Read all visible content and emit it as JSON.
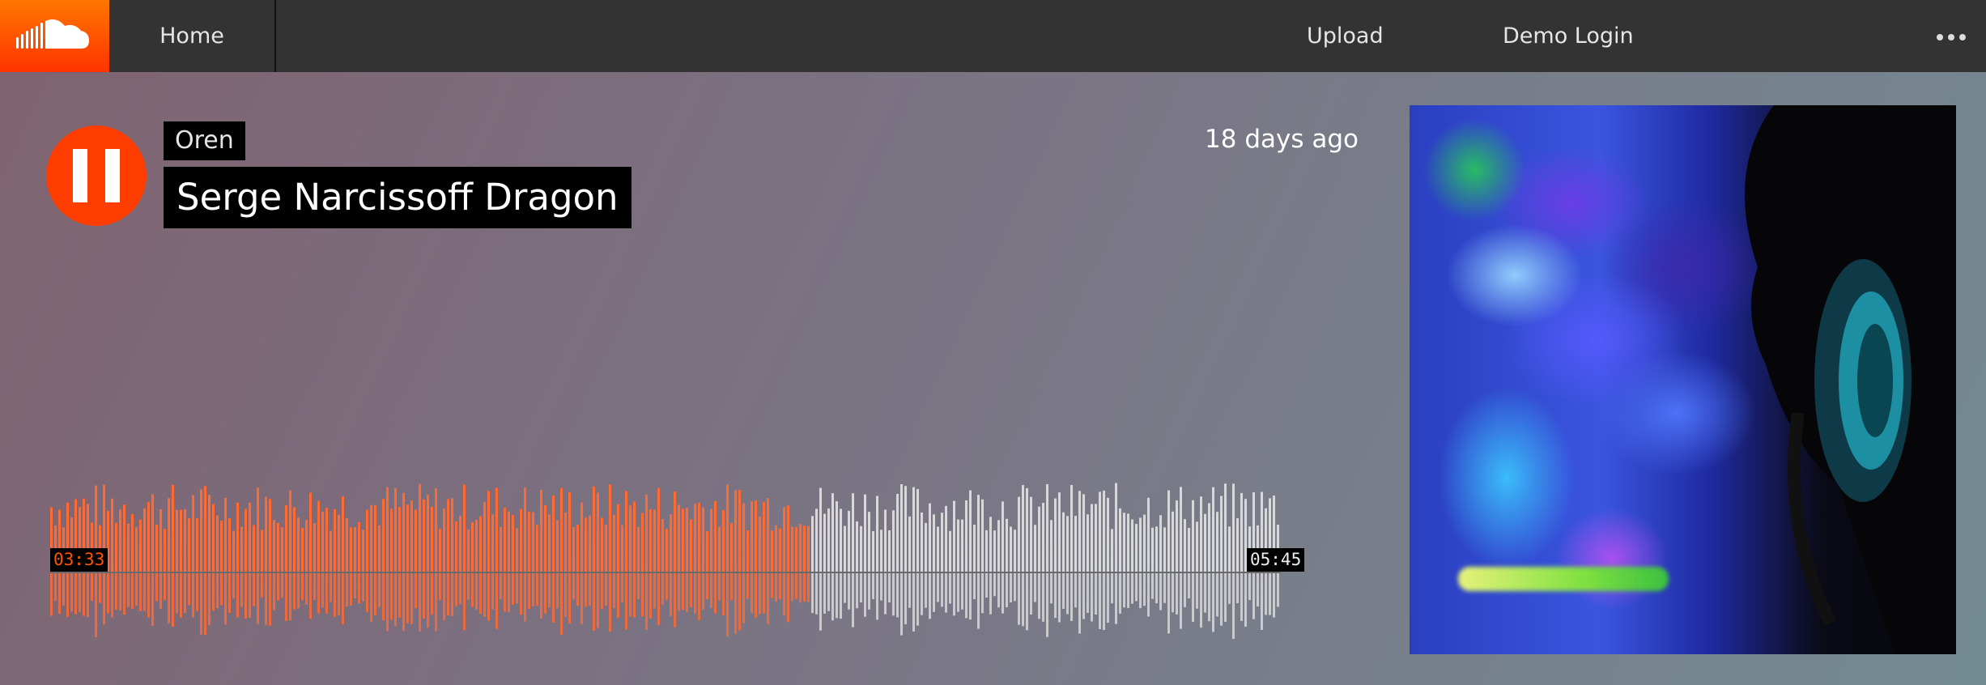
{
  "topbar": {
    "home_label": "Home",
    "upload_label": "Upload",
    "login_label": "Demo Login",
    "logo_icon": "soundcloud-cloud-icon",
    "more_icon": "more-dots-icon"
  },
  "player": {
    "state": "playing",
    "button_icon": "pause-icon",
    "artist": "Oren",
    "title": "Serge Narcissoff Dragon",
    "posted": "18 days ago",
    "current_time": "03:33",
    "duration": "05:45",
    "progress_fraction": 0.62
  },
  "artwork": {
    "description_icon": "track-artwork-image"
  },
  "colors": {
    "accent": "#ff5500",
    "played_wave": "#ff6a33",
    "unplayed_wave": "#d8d8d8",
    "topbar": "#333333"
  }
}
